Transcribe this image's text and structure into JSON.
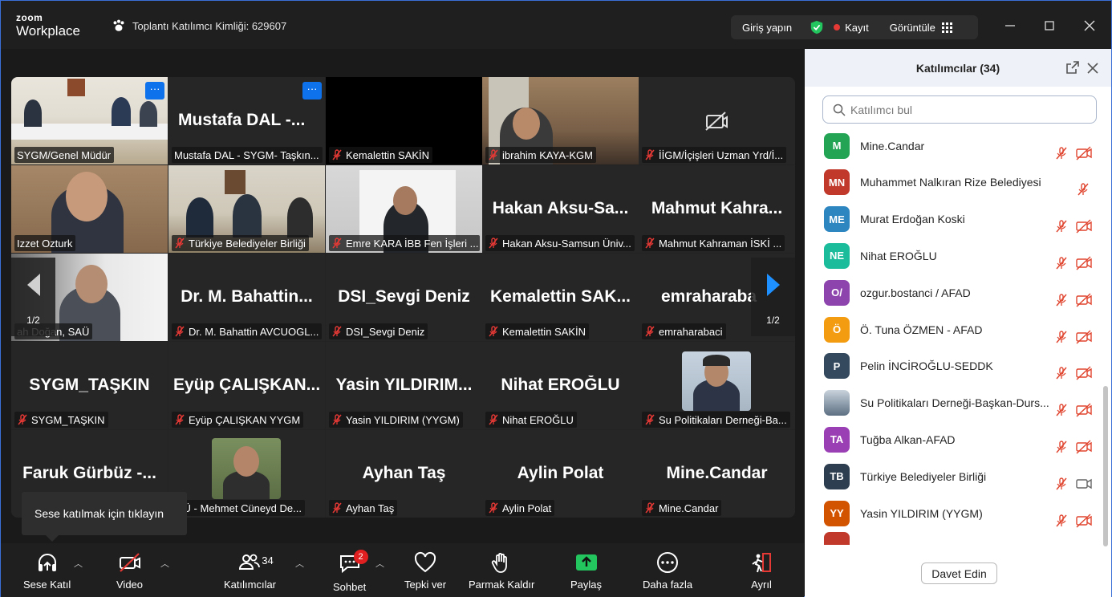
{
  "app": {
    "brand_top": "zoom",
    "brand_bottom": "Workplace",
    "meeting_id_label": "Toplantı Katılımcı Kimliği: 629607"
  },
  "topbar": {
    "signin": "Giriş yapın",
    "record": "Kayıt",
    "view": "Görüntüle"
  },
  "grid": {
    "page_left": "1/2",
    "page_right": "1/2",
    "tiles": [
      {
        "label": "SYGM/Genel Müdür",
        "big": "",
        "muted": false
      },
      {
        "label": "Mustafa DAL - SYGM- Taşkın...",
        "big": "Mustafa DAL -...",
        "muted": false
      },
      {
        "label": "Kemalettin SAKİN",
        "big": "",
        "muted": true
      },
      {
        "label": "ibrahim KAYA-KGM",
        "big": "",
        "muted": true
      },
      {
        "label": "İİGM/İçişleri Uzman Yrd/İ...",
        "big": "",
        "muted": true
      },
      {
        "label": "Izzet Ozturk",
        "big": "",
        "muted": false
      },
      {
        "label": "Türkiye Belediyeler Birliği",
        "big": "",
        "muted": true
      },
      {
        "label": "Emre KARA İBB Fen İşleri ...",
        "big": "",
        "muted": true
      },
      {
        "label": "Hakan Aksu-Samsun Üniv...",
        "big": "Hakan Aksu-Sa...",
        "muted": true
      },
      {
        "label": "Mahmut Kahraman İSKİ ...",
        "big": "Mahmut Kahra...",
        "muted": true
      },
      {
        "label": "ah Doğan, SAÜ",
        "big": "",
        "muted": false
      },
      {
        "label": "Dr. M. Bahattin AVCUOGL...",
        "big": "Dr. M. Bahattin...",
        "muted": true
      },
      {
        "label": "DSI_Sevgi Deniz",
        "big": "DSI_Sevgi Deniz",
        "muted": true
      },
      {
        "label": "Kemalettin SAKİN",
        "big": "Kemalettin SAK...",
        "muted": true
      },
      {
        "label": "emraharabaci",
        "big": "emraharaba",
        "muted": true
      },
      {
        "label": "SYGM_TAŞKIN",
        "big": "SYGM_TAŞKIN",
        "muted": true
      },
      {
        "label": "Eyüp ÇALIŞKAN YYGM",
        "big": "Eyüp ÇALIŞKAN...",
        "muted": true
      },
      {
        "label": "Yasin YILDIRIM (YYGM)",
        "big": "Yasin YILDIRIM...",
        "muted": true
      },
      {
        "label": "Nihat EROĞLU",
        "big": "Nihat EROĞLU",
        "muted": true
      },
      {
        "label": "Su Politikaları Derneği-Ba...",
        "big": "",
        "muted": true
      },
      {
        "label": "",
        "big": "Faruk Gürbüz -...",
        "muted": true
      },
      {
        "label": "İTÜ - Mehmet Cüneyd De...",
        "big": "",
        "muted": false
      },
      {
        "label": "Ayhan Taş",
        "big": "Ayhan Taş",
        "muted": true
      },
      {
        "label": "Aylin Polat",
        "big": "Aylin Polat",
        "muted": true
      },
      {
        "label": "Mine.Candar",
        "big": "Mine.Candar",
        "muted": true
      }
    ]
  },
  "tooltip": "Sese katılmak için tıklayın",
  "toolbar": {
    "audio": "Sese Katıl",
    "video": "Video",
    "participants": "Katılımcılar",
    "participants_count": "34",
    "chat": "Sohbet",
    "chat_badge": "2",
    "react": "Tepki ver",
    "raise": "Parmak Kaldır",
    "share": "Paylaş",
    "more": "Daha fazla",
    "leave": "Ayrıl"
  },
  "panel": {
    "title": "Katılımcılar (34)",
    "search_placeholder": "Katılımcı bul",
    "invite": "Davet Edin",
    "participants": [
      {
        "initials": "M",
        "name": "Mine.Candar",
        "color": "#23a455",
        "camera": "off"
      },
      {
        "initials": "MN",
        "name": "Muhammet Nalkıran Rize Belediyesi",
        "color": "#c0392b",
        "camera": "none"
      },
      {
        "initials": "ME",
        "name": "Murat Erdoğan Koski",
        "color": "#2e86c1",
        "camera": "off"
      },
      {
        "initials": "NE",
        "name": "Nihat EROĞLU",
        "color": "#1abc9c",
        "camera": "off"
      },
      {
        "initials": "O/",
        "name": "ozgur.bostanci / AFAD",
        "color": "#8e44ad",
        "camera": "off"
      },
      {
        "initials": "Ö",
        "name": "Ö. Tuna ÖZMEN - AFAD",
        "color": "#f39c12",
        "camera": "off"
      },
      {
        "initials": "P",
        "name": "Pelin İNCİROĞLU-SEDDK",
        "color": "#34495e",
        "camera": "off"
      },
      {
        "initials": "",
        "name": "Su Politikaları Derneği-Başkan-Durs...",
        "color": "#7a8a9a",
        "camera": "off"
      },
      {
        "initials": "TA",
        "name": "Tuğba Alkan-AFAD",
        "color": "#9b3fb5",
        "camera": "off"
      },
      {
        "initials": "TB",
        "name": "Türkiye Belediyeler Birliği",
        "color": "#2c3e50",
        "camera": "on"
      },
      {
        "initials": "YY",
        "name": "Yasin YILDIRIM (YYGM)",
        "color": "#d35400",
        "camera": "off"
      }
    ]
  }
}
